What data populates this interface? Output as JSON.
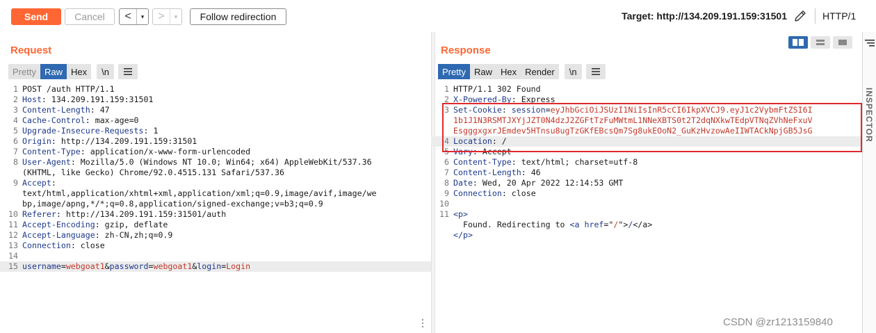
{
  "toolbar": {
    "send_label": "Send",
    "cancel_label": "Cancel",
    "back_arrow": "<",
    "forward_arrow": ">",
    "dropdown_caret": "▾",
    "follow_label": "Follow redirection",
    "target_text": "Target: http://134.209.191.159:31501",
    "http_version": "HTTP/1",
    "edit_icon": "pencil-icon"
  },
  "request": {
    "title": "Request",
    "tabs": [
      {
        "label": "Pretty",
        "active": false
      },
      {
        "label": "Raw",
        "active": true
      },
      {
        "label": "Hex",
        "active": false
      }
    ],
    "newline_label": "\\n",
    "menu_icon": "hamburger-icon",
    "lines": [
      {
        "n": "1",
        "h": "",
        "t": "POST /auth HTTP/1.1"
      },
      {
        "n": "2",
        "h": "Host",
        "t": ": 134.209.191.159:31501"
      },
      {
        "n": "3",
        "h": "Content-Length",
        "t": ": 47"
      },
      {
        "n": "4",
        "h": "Cache-Control",
        "t": ": max-age=0"
      },
      {
        "n": "5",
        "h": "Upgrade-Insecure-Requests",
        "t": ": 1"
      },
      {
        "n": "6",
        "h": "Origin",
        "t": ": http://134.209.191.159:31501"
      },
      {
        "n": "7",
        "h": "Content-Type",
        "t": ": application/x-www-form-urlencoded"
      },
      {
        "n": "8",
        "h": "User-Agent",
        "t": ": Mozilla/5.0 (Windows NT 10.0; Win64; x64) AppleWebKit/537.36"
      },
      {
        "n": "",
        "h": "",
        "t": "(KHTML, like Gecko) Chrome/92.0.4515.131 Safari/537.36"
      },
      {
        "n": "9",
        "h": "Accept",
        "t": ":"
      },
      {
        "n": "",
        "h": "",
        "t": "text/html,application/xhtml+xml,application/xml;q=0.9,image/avif,image/we"
      },
      {
        "n": "",
        "h": "",
        "t": "bp,image/apng,*/*;q=0.8,application/signed-exchange;v=b3;q=0.9"
      },
      {
        "n": "10",
        "h": "Referer",
        "t": ": http://134.209.191.159:31501/auth"
      },
      {
        "n": "11",
        "h": "Accept-Encoding",
        "t": ": gzip, deflate"
      },
      {
        "n": "12",
        "h": "Accept-Language",
        "t": ": zh-CN,zh;q=0.9"
      },
      {
        "n": "13",
        "h": "Connection",
        "t": ": close"
      },
      {
        "n": "14",
        "h": "",
        "t": ""
      }
    ],
    "body_line": {
      "n": "15",
      "params": [
        {
          "key": "username",
          "val": "webgoat1"
        },
        {
          "key": "password",
          "val": "webgoat1"
        },
        {
          "key": "login",
          "val": "Login"
        }
      ]
    }
  },
  "response": {
    "title": "Response",
    "tabs": [
      {
        "label": "Pretty",
        "active": true
      },
      {
        "label": "Raw",
        "active": false
      },
      {
        "label": "Hex",
        "active": false
      },
      {
        "label": "Render",
        "active": false
      }
    ],
    "newline_label": "\\n",
    "menu_icon": "hamburger-icon",
    "view_toggle": [
      "split-horizontal-icon",
      "split-vertical-icon",
      "single-pane-icon"
    ],
    "lines": [
      {
        "n": "1",
        "h": "",
        "t": "HTTP/1.1 302 Found"
      },
      {
        "n": "2",
        "h": "X-Powered-By",
        "t": ": Express"
      },
      {
        "n": "3",
        "h": "Set-Cookie",
        "t": ": ",
        "cookie_name": "session",
        "cookie_val": "eyJhbGciOiJSUzI1NiIsInR5cCI6IkpXVCJ9.eyJ1c2VybmFtZSI6I"
      },
      {
        "n": "",
        "h": "",
        "t": "1b1J1N3RSMTJXYjJZT0N4dzJ2ZGFtTzFuMWtmL1NNeXBTS0t2T2dqNXkwTEdpVTNqZVhNeFxuV",
        "cookie_cont": true
      },
      {
        "n": "",
        "h": "",
        "t": "EsgggxgxrJEmdev5HTnsu8ugTzGKfEBcsQm7Sg8ukEOoN2_GuKzHvzowAeIIWTACkNpjGB5JsG",
        "cookie_cont": true
      },
      {
        "n": "4",
        "h": "Location",
        "t": ": /",
        "hl": true
      },
      {
        "n": "5",
        "h": "Vary",
        "t": ": Accept"
      },
      {
        "n": "6",
        "h": "Content-Type",
        "t": ": text/html; charset=utf-8"
      },
      {
        "n": "7",
        "h": "Content-Length",
        "t": ": 46"
      },
      {
        "n": "8",
        "h": "Date",
        "t": ": Wed, 20 Apr 2022 12:14:53 GMT"
      },
      {
        "n": "9",
        "h": "Connection",
        "t": ": close"
      },
      {
        "n": "10",
        "h": "",
        "t": ""
      }
    ],
    "html_lines": [
      {
        "n": "11",
        "parts": [
          {
            "c": "tg",
            "t": "<p>"
          }
        ]
      },
      {
        "n": "",
        "parts": [
          {
            "c": "",
            "t": "  Found. Redirecting to "
          },
          {
            "c": "tg",
            "t": "<a "
          },
          {
            "c": "k",
            "t": "href"
          },
          {
            "c": "",
            "t": "=\""
          },
          {
            "c": "sv",
            "t": "/"
          },
          {
            "c": "",
            "t": "\">"
          },
          {
            "c": "tg",
            "t": "/"
          },
          {
            "c": "",
            "t": "</a>"
          }
        ]
      },
      {
        "n": "",
        "parts": [
          {
            "c": "tg",
            "t": "</p>"
          }
        ]
      }
    ]
  },
  "inspector": {
    "label": "INSPECTOR",
    "icon": "filter-lines-icon"
  },
  "watermark": "CSDN @zr1213159840",
  "colors": {
    "accent": "#ff6633",
    "tab_active": "#2f69b1",
    "highlight_box": "#e0282e",
    "header_key": "#1f3a8a",
    "value_red": "#c0392b"
  }
}
